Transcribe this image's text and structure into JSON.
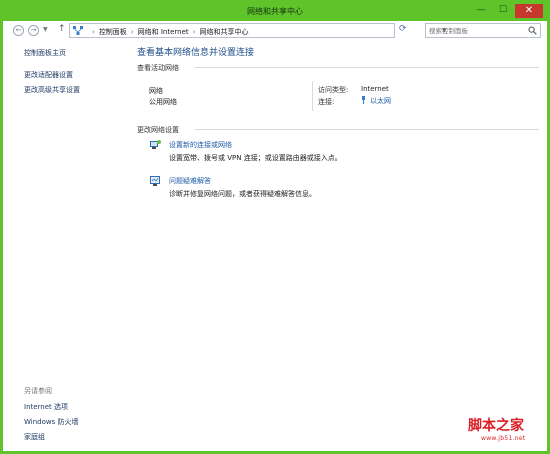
{
  "window": {
    "title": "网络和共享中心",
    "minimize": "—",
    "maximize": "☐",
    "close": "✕",
    "frame_color": "#5fc32a"
  },
  "address": {
    "breadcrumbs": [
      "控制面板",
      "网络和 Internet",
      "网络和共享中心"
    ],
    "search_placeholder": "搜索控制面板"
  },
  "sidebar": {
    "links": [
      "控制面板主页",
      "更改适配器设置",
      "更改高级共享设置"
    ],
    "see_also_title": "另请参阅",
    "see_also": [
      "Internet 选项",
      "Windows 防火墙",
      "家庭组"
    ]
  },
  "main": {
    "title": "查看基本网络信息并设置连接",
    "active_networks_heading": "查看活动网络",
    "network": {
      "name": "网络",
      "type": "公用网络",
      "access_type_label": "访问类型:",
      "access_type_value": "Internet",
      "connections_label": "连接:",
      "connections_value": "以太网"
    },
    "change_settings_heading": "更改网络设置",
    "tasks": [
      {
        "icon": "new-connection-icon",
        "title": "设置新的连接或网络",
        "description": "设置宽带、拨号或 VPN 连接；或设置路由器或接入点。"
      },
      {
        "icon": "troubleshoot-icon",
        "title": "问题疑难解答",
        "description": "诊断并修复网络问题，或者获得疑难解答信息。"
      }
    ]
  },
  "watermark": {
    "title": "脚本之家",
    "url": "www.jb51.net"
  }
}
